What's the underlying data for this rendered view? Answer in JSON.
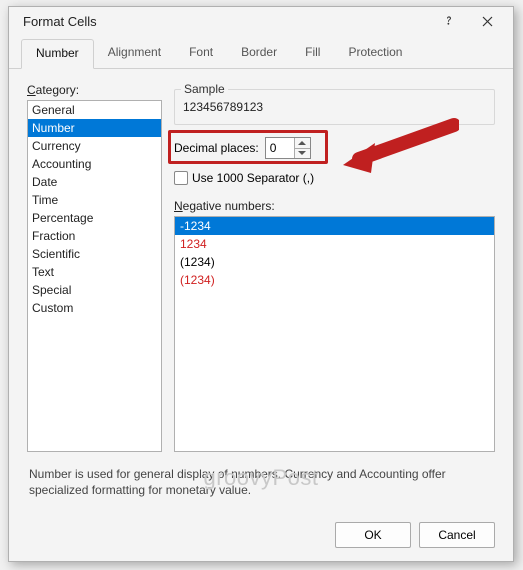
{
  "dialog": {
    "title": "Format Cells"
  },
  "tabs": {
    "items": [
      {
        "label": "Number",
        "active": true
      },
      {
        "label": "Alignment"
      },
      {
        "label": "Font"
      },
      {
        "label": "Border"
      },
      {
        "label": "Fill"
      },
      {
        "label": "Protection"
      }
    ]
  },
  "category": {
    "label_prefix": "C",
    "label_rest": "ategory:",
    "items": [
      "General",
      "Number",
      "Currency",
      "Accounting",
      "Date",
      "Time",
      "Percentage",
      "Fraction",
      "Scientific",
      "Text",
      "Special",
      "Custom"
    ],
    "selected_index": 1
  },
  "sample": {
    "legend": "Sample",
    "value": "123456789123"
  },
  "decimal": {
    "label_prefix": "D",
    "label_rest": "ecimal places:",
    "value": "0"
  },
  "separator": {
    "label_prefix": "U",
    "label_rest": "se 1000 Separator (,)",
    "checked": false
  },
  "negative": {
    "label_prefix": "N",
    "label_rest": "egative numbers:",
    "items": [
      {
        "text": "-1234",
        "selected": true
      },
      {
        "text": "1234",
        "red": true
      },
      {
        "text": "(1234)"
      },
      {
        "text": "(1234)",
        "red": true
      }
    ]
  },
  "description": "Number is used for general display of numbers.  Currency and Accounting offer specialized formatting for monetary value.",
  "buttons": {
    "ok": "OK",
    "cancel": "Cancel"
  },
  "watermark": "groovyPost"
}
